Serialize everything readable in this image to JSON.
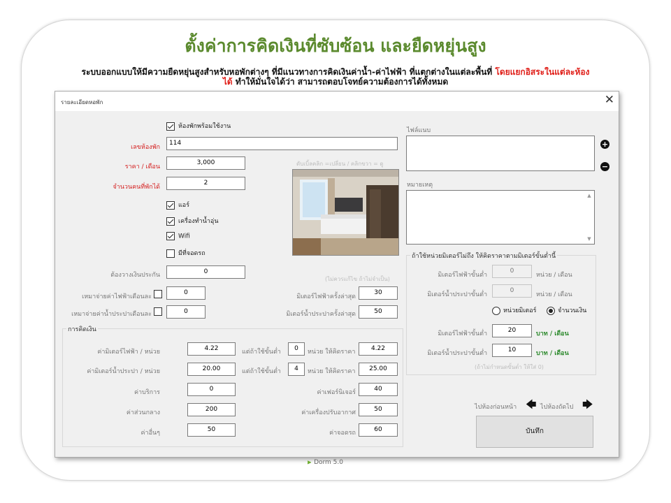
{
  "headline": "ตั้งค่าการคิดเงินที่ซับซ้อน และยืดหยุ่นสูง",
  "subtitle": {
    "part1": "ระบบออกแบบให้มีความยืดหยุ่นสูงสำหรับหอพักต่างๆ ที่มีแนวทางการคิดเงินค่าน้ำ-ค่าไฟฟ้า ที่แตกต่างในแต่ละพื้นที่ ",
    "part2_red": "โดยแยกอิสระในแต่ละห้องได้",
    "part3": " ทำให้มั่นใจได้ว่า สามารถตอบโจทย์ความต้องการได้ทั้งหมด"
  },
  "window": {
    "title": "รายละเอียดหอพัก",
    "close_glyph": "✕"
  },
  "room_ready": {
    "label": "ห้องพักพร้อมใช้งาน",
    "checked": true
  },
  "room_no": {
    "label": "เลขห้องพัก",
    "value": "114"
  },
  "price": {
    "label": "ราคา / เดือน",
    "value": "3,000"
  },
  "capacity": {
    "label": "จำนวนคนที่พักได้",
    "value": "2"
  },
  "photo_hint": "ดับเบิ้ลคลิก =เปลี่ยน / คลิกขวา = ดู",
  "amenities": [
    {
      "label": "แอร์",
      "checked": true
    },
    {
      "label": "เครื่องทำน้ำอุ่น",
      "checked": true
    },
    {
      "label": "Wifi",
      "checked": true
    },
    {
      "label": "มีที่จอดรถ",
      "checked": false
    }
  ],
  "deposit": {
    "label": "ต้องวางเงินประกัน",
    "value": "0"
  },
  "deposit_hint": "(ไม่ควรแก้ไข ถ้าไม่จำเป็น)",
  "elec_advance": {
    "label": "เหมาจ่ายค่าไฟฟ้าเดือนละ",
    "checked": false,
    "value": "0"
  },
  "water_advance": {
    "label": "เหมาจ่ายค่าน้ำประปาเดือนละ",
    "checked": false,
    "value": "0"
  },
  "last_elec": {
    "label": "มิเตอร์ไฟฟ้าครั้งล่าสุด",
    "value": "30"
  },
  "last_water": {
    "label": "มิเตอร์น้ำประปาครั้งล่าสุด",
    "value": "50"
  },
  "billing": {
    "title": "การคิดเงิน",
    "elec_rate": {
      "label": "ค่ามิเตอร์ไฟฟ้า / หน่วย",
      "value": "4.22",
      "min_label": "แต่ถ้าใช้ขั้นต่ำ",
      "min_value": "0",
      "unit_label": "หน่วย ให้คิดราคา",
      "min_price": "4.22"
    },
    "water_rate": {
      "label": "ค่ามิเตอร์น้ำประปา / หน่วย",
      "value": "20.00",
      "min_label": "แต่ถ้าใช้ขั้นต่ำ",
      "min_value": "4",
      "unit_label": "หน่วย ให้คิดราคา",
      "min_price": "25.00"
    },
    "service": {
      "label": "ค่าบริการ",
      "value": "0"
    },
    "common": {
      "label": "ค่าส่วนกลาง",
      "value": "200"
    },
    "other": {
      "label": "ค่าอื่นๆ",
      "value": "50"
    },
    "furniture": {
      "label": "ค่าเฟอร์นิเจอร์",
      "value": "40"
    },
    "aircon": {
      "label": "ค่าเครื่องปรับอากาศ",
      "value": "50"
    },
    "parking": {
      "label": "ค่าจอดรถ",
      "value": "60"
    }
  },
  "attachments": {
    "label": "ไฟล์แนบ",
    "add": "+",
    "remove": "−"
  },
  "notes": {
    "label": "หมายเหตุ",
    "scroll_up": "▲",
    "scroll_down": "▼"
  },
  "minimum": {
    "title": "ถ้าใช้หน่วยมิเตอร์ไม่ถึง ให้คิดราคาตามมิเตอร์ขั้นต่ำนี้",
    "elec_units": {
      "label": "มิเตอร์ไฟฟ้าขั้นต่ำ",
      "value": "0",
      "unit": "หน่วย / เดือน"
    },
    "water_units": {
      "label": "มิเตอร์น้ำประปาขั้นต่ำ",
      "value": "0",
      "unit": "หน่วย / เดือน"
    },
    "radio_units": "หน่วยมิเตอร์",
    "radio_money": "จำนวนเงิน",
    "elec_money": {
      "label": "มิเตอร์ไฟฟ้าขั้นต่ำ",
      "value": "20",
      "unit": "บาท / เดือน"
    },
    "water_money": {
      "label": "มิเตอร์น้ำประปาขั้นต่ำ",
      "value": "10",
      "unit": "บาท / เดือน"
    },
    "hint": "(ถ้าไม่กำหนดขั้นต่ำ ให้ใส่ 0)"
  },
  "nav": {
    "prev": "ไปห้องก่อนหน้า",
    "next": "ไปห้องถัดไป",
    "prev_arrow": "🡄",
    "next_arrow": "🡆"
  },
  "save": "บันทึก",
  "footer": {
    "logo": "⫸",
    "text": "Dorm 5.0"
  }
}
